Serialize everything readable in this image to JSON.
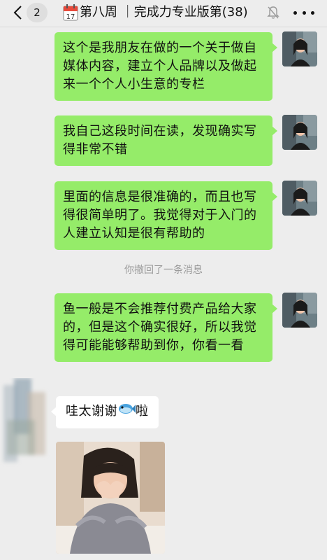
{
  "header": {
    "unread_count": "2",
    "title": "第八周 ｜完成力专业版第(38)",
    "calendar_day": "17"
  },
  "messages": [
    {
      "type": "sent",
      "text": "这个是我朋友在做的一个关于做自媒体内容，建立个人品牌以及做起来一个个人小生意的专栏"
    },
    {
      "type": "sent",
      "text": "我自己这段时间在读，发现确实写得非常不错"
    },
    {
      "type": "sent",
      "text": "里面的信息是很准确的，而且也写得很简单明了。我觉得对于入门的人建立认知是很有帮助的"
    },
    {
      "type": "system",
      "text": "你撤回了一条消息"
    },
    {
      "type": "sent",
      "text": "鱼一般是不会推荐付费产品给大家的，但是这个确实很好，所以我觉得可能能够帮助到你，你看一看"
    },
    {
      "type": "received",
      "text": "哇太谢谢",
      "suffix": "啦"
    }
  ],
  "colors": {
    "sent_bubble": "#95ec69",
    "received_bubble": "#ffffff",
    "background": "#ededed"
  }
}
